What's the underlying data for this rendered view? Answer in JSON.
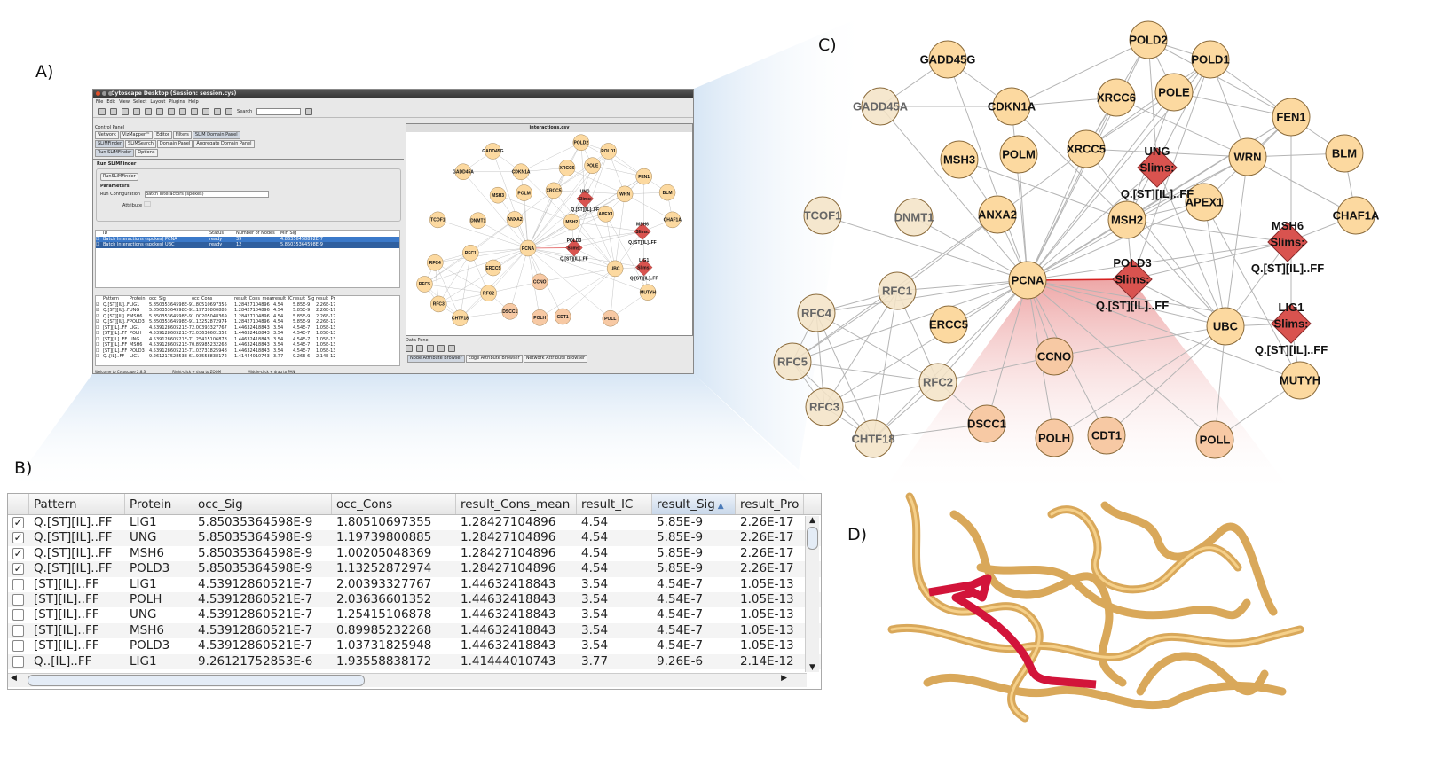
{
  "panel_labels": {
    "a": "A)",
    "b": "B)",
    "c": "C)",
    "d": "D)"
  },
  "app": {
    "title": "Cytoscape Desktop (Session: session.cys)",
    "menu": [
      "File",
      "Edit",
      "View",
      "Select",
      "Layout",
      "Plugins",
      "Help"
    ],
    "search_label": "Search",
    "control_panel_label": "Control Panel",
    "main_tabs": [
      "Network",
      "VizMapper™",
      "Editor",
      "Filters",
      "SLiM Domain Panel"
    ],
    "sub_tabs": [
      "SLiMFinder",
      "SLiMSearch",
      "Domain Panel",
      "Aggregate Domain Panel"
    ],
    "run_tabs": [
      "Run SLiMFinder",
      "Options"
    ],
    "section_title": "Run SLiMFinder",
    "run_button": "RunSLiMFinder",
    "parameters_label": "Parameters",
    "run_config_label": "Run Configuration",
    "run_config_value": "Batch Interactors (spokes)",
    "attribute_label": "Attribute",
    "runs_headers": [
      "ID",
      "Status",
      "Number of Nodes",
      "Min Sig"
    ],
    "runs": [
      [
        "Batch Interactions (spokes) PCNA",
        "ready",
        "39",
        "4.86356458892E-7"
      ],
      [
        "Batch Interactions (spokes) UBC",
        "ready",
        "12",
        "5.85035364598E-9"
      ]
    ],
    "network_window_title": "interactions.csv",
    "data_panel_label": "Data Panel",
    "data_tabs": [
      "Node Attribute Browser",
      "Edge Attribute Browser",
      "Network Attribute Browser"
    ],
    "status_bar": [
      "Welcome to Cytoscape 2.8.3",
      "Right-click + drag to ZOOM",
      "Middle-click + drag to PAN"
    ]
  },
  "results_table": {
    "headers": [
      "Pattern",
      "Protein",
      "occ_Sig",
      "occ_Cons",
      "result_Cons_mean",
      "result_IC",
      "result_Sig",
      "result_Pro"
    ],
    "sort_column": "result_Sig",
    "sort_icon": "triangle-up-icon",
    "rows": [
      {
        "checked": true,
        "cells": [
          "Q.[ST][IL]..FF",
          "LIG1",
          "5.85035364598E-9",
          "1.80510697355",
          "1.28427104896",
          "4.54",
          "5.85E-9",
          "2.26E-17"
        ]
      },
      {
        "checked": true,
        "cells": [
          "Q.[ST][IL]..FF",
          "UNG",
          "5.85035364598E-9",
          "1.19739800885",
          "1.28427104896",
          "4.54",
          "5.85E-9",
          "2.26E-17"
        ]
      },
      {
        "checked": true,
        "cells": [
          "Q.[ST][IL]..FF",
          "MSH6",
          "5.85035364598E-9",
          "1.00205048369",
          "1.28427104896",
          "4.54",
          "5.85E-9",
          "2.26E-17"
        ]
      },
      {
        "checked": true,
        "cells": [
          "Q.[ST][IL]..FF",
          "POLD3",
          "5.85035364598E-9",
          "1.13252872974",
          "1.28427104896",
          "4.54",
          "5.85E-9",
          "2.26E-17"
        ]
      },
      {
        "checked": false,
        "cells": [
          "[ST][IL]..FF",
          "LIG1",
          "4.53912860521E-7",
          "2.00393327767",
          "1.44632418843",
          "3.54",
          "4.54E-7",
          "1.05E-13"
        ]
      },
      {
        "checked": false,
        "cells": [
          "[ST][IL]..FF",
          "POLH",
          "4.53912860521E-7",
          "2.03636601352",
          "1.44632418843",
          "3.54",
          "4.54E-7",
          "1.05E-13"
        ]
      },
      {
        "checked": false,
        "cells": [
          "[ST][IL]..FF",
          "UNG",
          "4.53912860521E-7",
          "1.25415106878",
          "1.44632418843",
          "3.54",
          "4.54E-7",
          "1.05E-13"
        ]
      },
      {
        "checked": false,
        "cells": [
          "[ST][IL]..FF",
          "MSH6",
          "4.53912860521E-7",
          "0.89985232268",
          "1.44632418843",
          "3.54",
          "4.54E-7",
          "1.05E-13"
        ]
      },
      {
        "checked": false,
        "cells": [
          "[ST][IL]..FF",
          "POLD3",
          "4.53912860521E-7",
          "1.03731825948",
          "1.44632418843",
          "3.54",
          "4.54E-7",
          "1.05E-13"
        ]
      },
      {
        "checked": false,
        "cells": [
          "Q..[IL]..FF",
          "LIG1",
          "9.26121752853E-6",
          "1.93558838172",
          "1.41444010743",
          "3.77",
          "9.26E-6",
          "2.14E-12"
        ]
      }
    ]
  },
  "network": {
    "node_color": "#fcd9a0",
    "slim_color": "#d9534f",
    "highlight_edge_color": "#d62020",
    "slim_label": "Slims:",
    "slim_motif": "Q.[ST][IL]..FF",
    "nodes": [
      "GADD45G",
      "GADD45A",
      "CDKN1A",
      "POLD2",
      "POLD1",
      "XRCC6",
      "POLE",
      "FEN1",
      "BLM",
      "MSH3",
      "POLM",
      "XRCC5",
      "WRN",
      "CHAF1A",
      "TCOF1",
      "DNMT1",
      "ANXA2",
      "MSH2",
      "APEX1",
      "PCNA",
      "RFC1",
      "RFC4",
      "ERCC5",
      "UBC",
      "RFC5",
      "CCNO",
      "RFC2",
      "MUTYH",
      "RFC3",
      "DSCC1",
      "CHTF18",
      "POLH",
      "CDT1",
      "POLL"
    ],
    "slim_nodes": [
      "UNG",
      "MSH6",
      "POLD3",
      "LIG1"
    ],
    "edges": [
      [
        "PCNA",
        "GADD45A"
      ],
      [
        "PCNA",
        "GADD45G"
      ],
      [
        "PCNA",
        "CDKN1A"
      ],
      [
        "PCNA",
        "POLD2"
      ],
      [
        "PCNA",
        "POLD1"
      ],
      [
        "PCNA",
        "XRCC6"
      ],
      [
        "PCNA",
        "POLE"
      ],
      [
        "PCNA",
        "FEN1"
      ],
      [
        "PCNA",
        "POLM"
      ],
      [
        "PCNA",
        "XRCC5"
      ],
      [
        "PCNA",
        "WRN"
      ],
      [
        "PCNA",
        "TCOF1"
      ],
      [
        "PCNA",
        "DNMT1"
      ],
      [
        "PCNA",
        "ANXA2"
      ],
      [
        "PCNA",
        "MSH2"
      ],
      [
        "PCNA",
        "APEX1"
      ],
      [
        "PCNA",
        "MSH6"
      ],
      [
        "PCNA",
        "UNG"
      ],
      [
        "PCNA",
        "RFC1"
      ],
      [
        "PCNA",
        "RFC4"
      ],
      [
        "PCNA",
        "RFC5"
      ],
      [
        "PCNA",
        "ERCC5"
      ],
      [
        "PCNA",
        "UBC"
      ],
      [
        "PCNA",
        "LIG1"
      ],
      [
        "PCNA",
        "CCNO"
      ],
      [
        "PCNA",
        "RFC2"
      ],
      [
        "PCNA",
        "MUTYH"
      ],
      [
        "PCNA",
        "RFC3"
      ],
      [
        "PCNA",
        "DSCC1"
      ],
      [
        "PCNA",
        "CHTF18"
      ],
      [
        "PCNA",
        "POLH"
      ],
      [
        "PCNA",
        "CDT1"
      ],
      [
        "PCNA",
        "POLL"
      ],
      [
        "GADD45G",
        "GADD45A"
      ],
      [
        "GADD45G",
        "CDKN1A"
      ],
      [
        "GADD45A",
        "CDKN1A"
      ],
      [
        "CDKN1A",
        "POLD2"
      ],
      [
        "CDKN1A",
        "XRCC6"
      ],
      [
        "CDKN1A",
        "MSH2"
      ],
      [
        "POLD2",
        "POLD1"
      ],
      [
        "POLD2",
        "POLE"
      ],
      [
        "POLD2",
        "FEN1"
      ],
      [
        "POLD2",
        "XRCC5"
      ],
      [
        "POLD2",
        "UNG"
      ],
      [
        "POLD1",
        "POLE"
      ],
      [
        "POLD1",
        "FEN1"
      ],
      [
        "POLD1",
        "WRN"
      ],
      [
        "POLD1",
        "MSH2"
      ],
      [
        "POLD1",
        "XRCC5"
      ],
      [
        "POLD1",
        "POLD3"
      ],
      [
        "XRCC6",
        "XRCC5"
      ],
      [
        "XRCC6",
        "WRN"
      ],
      [
        "POLE",
        "FEN1"
      ],
      [
        "POLE",
        "MSH2"
      ],
      [
        "POLE",
        "XRCC5"
      ],
      [
        "FEN1",
        "WRN"
      ],
      [
        "FEN1",
        "BLM"
      ],
      [
        "FEN1",
        "LIG1"
      ],
      [
        "FEN1",
        "APEX1"
      ],
      [
        "FEN1",
        "MSH2"
      ],
      [
        "BLM",
        "WRN"
      ],
      [
        "BLM",
        "CHAF1A"
      ],
      [
        "WRN",
        "XRCC5"
      ],
      [
        "WRN",
        "UBC"
      ],
      [
        "WRN",
        "CHAF1A"
      ],
      [
        "WRN",
        "MSH2"
      ],
      [
        "MSH3",
        "MSH2"
      ],
      [
        "MSH3",
        "ANXA2"
      ],
      [
        "XRCC5",
        "UBC"
      ],
      [
        "XRCC5",
        "RFC1"
      ],
      [
        "MSH2",
        "MSH6"
      ],
      [
        "MSH2",
        "UBC"
      ],
      [
        "MSH2",
        "POLD3"
      ],
      [
        "APEX1",
        "UBC"
      ],
      [
        "APEX1",
        "MUTYH"
      ],
      [
        "APEX1",
        "MSH2"
      ],
      [
        "CHAF1A",
        "MSH6"
      ],
      [
        "UBC",
        "LIG1"
      ],
      [
        "UBC",
        "MSH6"
      ],
      [
        "UBC",
        "CCNO"
      ],
      [
        "UBC",
        "CDT1"
      ],
      [
        "UBC",
        "POLH"
      ],
      [
        "UBC",
        "POLL"
      ],
      [
        "UBC",
        "UNG"
      ],
      [
        "MUTYH",
        "POLL"
      ],
      [
        "MUTYH",
        "LIG1"
      ],
      [
        "POLD3",
        "MSH6"
      ],
      [
        "POLD3",
        "UBC"
      ],
      [
        "RFC1",
        "RFC4"
      ],
      [
        "RFC1",
        "RFC5"
      ],
      [
        "RFC1",
        "RFC2"
      ],
      [
        "RFC1",
        "RFC3"
      ],
      [
        "RFC1",
        "CHTF18"
      ],
      [
        "RFC4",
        "RFC5"
      ],
      [
        "RFC4",
        "RFC2"
      ],
      [
        "RFC4",
        "RFC3"
      ],
      [
        "RFC4",
        "CHTF18"
      ],
      [
        "RFC5",
        "RFC2"
      ],
      [
        "RFC5",
        "RFC3"
      ],
      [
        "RFC5",
        "CHTF18"
      ],
      [
        "RFC2",
        "RFC3"
      ],
      [
        "RFC2",
        "CHTF18"
      ],
      [
        "RFC2",
        "DSCC1"
      ],
      [
        "RFC2",
        "CCNO"
      ],
      [
        "RFC3",
        "CHTF18"
      ],
      [
        "CHTF18",
        "DSCC1"
      ],
      [
        "ANXA2",
        "RFC5"
      ]
    ]
  }
}
